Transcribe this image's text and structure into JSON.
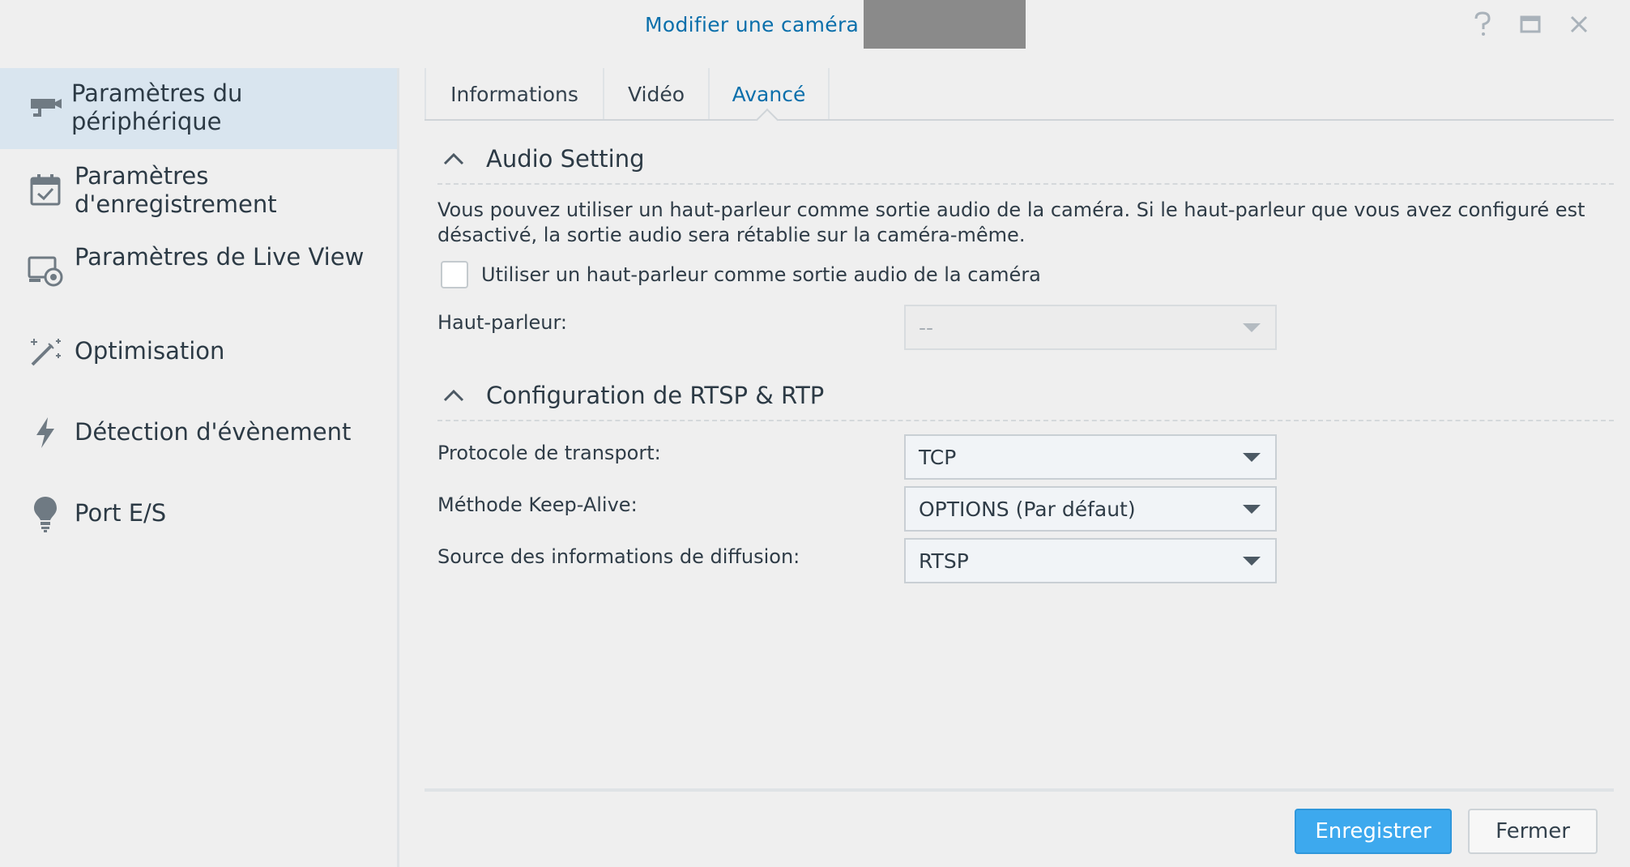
{
  "window": {
    "title": "Modifier une caméra",
    "controls": {
      "help_icon": "question-icon",
      "maximize_icon": "maximize-icon",
      "close_icon": "close-icon"
    }
  },
  "sidebar": {
    "items": [
      {
        "label": "Paramètres du périphérique",
        "icon": "camera-icon",
        "active": true
      },
      {
        "label": "Paramètres d'enregistrement",
        "icon": "calendar-check-icon",
        "active": false
      },
      {
        "label": "Paramètres de Live View",
        "icon": "live-view-icon",
        "active": false
      },
      {
        "label": "Optimisation",
        "icon": "magic-wand-icon",
        "active": false
      },
      {
        "label": "Détection d'évènement",
        "icon": "lightning-icon",
        "active": false
      },
      {
        "label": "Port E/S",
        "icon": "bulb-icon",
        "active": false
      }
    ]
  },
  "tabs": [
    {
      "label": "Informations",
      "active": false
    },
    {
      "label": "Vidéo",
      "active": false
    },
    {
      "label": "Avancé",
      "active": true
    }
  ],
  "audio_section": {
    "title": "Audio Setting",
    "description": "Vous pouvez utiliser un haut-parleur comme sortie audio de la caméra. Si le haut-parleur que vous avez configuré est désactivé, la sortie audio sera rétablie sur la caméra-même.",
    "checkbox_label": "Utiliser un haut-parleur comme sortie audio de la caméra",
    "checkbox_checked": false,
    "speaker_label": "Haut-parleur:",
    "speaker_value": "--"
  },
  "rtsp_section": {
    "title": "Configuration de RTSP & RTP",
    "transport_label": "Protocole de transport:",
    "transport_value": "TCP",
    "keepalive_label": "Méthode Keep-Alive:",
    "keepalive_value": "OPTIONS (Par défaut)",
    "source_label": "Source des informations de diffusion:",
    "source_value": "RTSP"
  },
  "footer": {
    "save_label": "Enregistrer",
    "close_label": "Fermer"
  },
  "colors": {
    "accent": "#0a6fab",
    "primary_button": "#3da9ee",
    "sidebar_active": "#d9e5ef",
    "background": "#efefef"
  }
}
